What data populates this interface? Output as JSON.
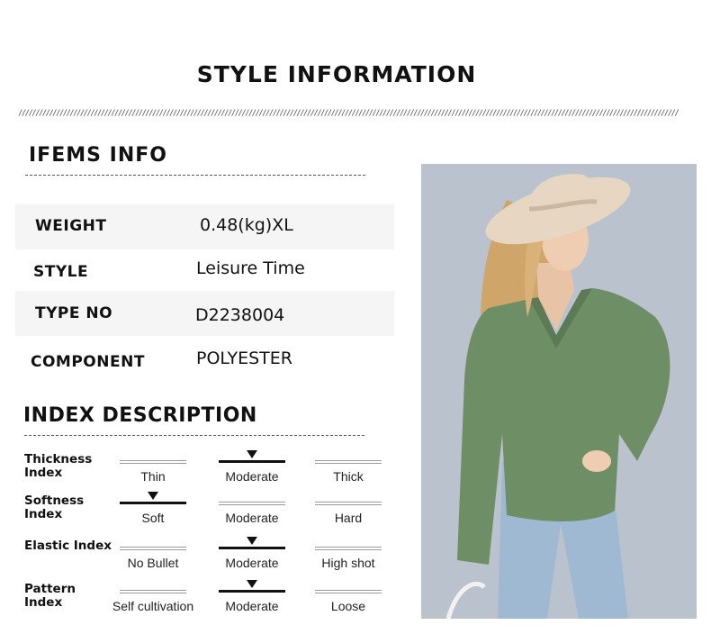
{
  "page_title": "STYLE INFORMATION",
  "slash_rule": "////////////////////////////////////////////////////////////////////////////////////////////////////////////////////////////////////////////////////////////////////////////////////////////////",
  "items_info": {
    "heading": "IFEMS INFO",
    "rows": [
      {
        "label": "WEIGHT",
        "value": "0.48(kg)XL"
      },
      {
        "label": "STYLE",
        "value": "Leisure Time"
      },
      {
        "label": "TYPE NO",
        "value": "D2238004"
      },
      {
        "label": "COMPONENT",
        "value": "POLYESTER"
      }
    ]
  },
  "index_description": {
    "heading": "INDEX DESCRIPTION",
    "rows": [
      {
        "label": "Thickness Index",
        "options": [
          "Thin",
          "Moderate",
          "Thick"
        ],
        "selected": 1
      },
      {
        "label": "Softness Index",
        "options": [
          "Soft",
          "Moderate",
          "Hard"
        ],
        "selected": 0
      },
      {
        "label": "Elastic Index",
        "options": [
          "No Bullet",
          "Moderate",
          "High shot"
        ],
        "selected": 1
      },
      {
        "label": "Pattern Index",
        "options": [
          "Self cultivation",
          "Moderate",
          "Loose"
        ],
        "selected": 1
      }
    ]
  },
  "colors": {
    "sweater": "#6e8f66",
    "hat": "#e6d6c2",
    "wall": "#b4bec8",
    "jeans": "#9fb9d3"
  }
}
